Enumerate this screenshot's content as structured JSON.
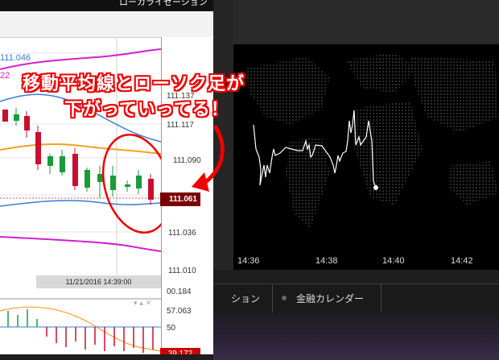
{
  "header": {
    "label": "ローカライゼーション"
  },
  "left_chart": {
    "legend_price": "111.046",
    "legend_num": "22",
    "price_ticks": [
      "111.137",
      "111.117",
      "111.090",
      "111.061",
      "111.036",
      "111.010",
      "57.063",
      "50"
    ],
    "price_tick_clipped": "00.184",
    "current_price": "111.061",
    "timestamp": "11/21/2016 14:39:00",
    "bottom_badge": "39.172",
    "colors": {
      "bullish": "#1a9b3a",
      "bearish": "#c8102e",
      "ma_fast": "#3a7bd5",
      "ma_slow": "#f5a020",
      "band": "#d020d0"
    }
  },
  "annotation": {
    "line1": "移動平均線とローソク足が",
    "line2": "下がっていってる！"
  },
  "right_map": {
    "time_ticks": [
      "14:36",
      "14:38",
      "14:40",
      "14:42"
    ]
  },
  "tabs": [
    {
      "label": "ション"
    },
    {
      "label": "金融カレンダー"
    }
  ]
}
